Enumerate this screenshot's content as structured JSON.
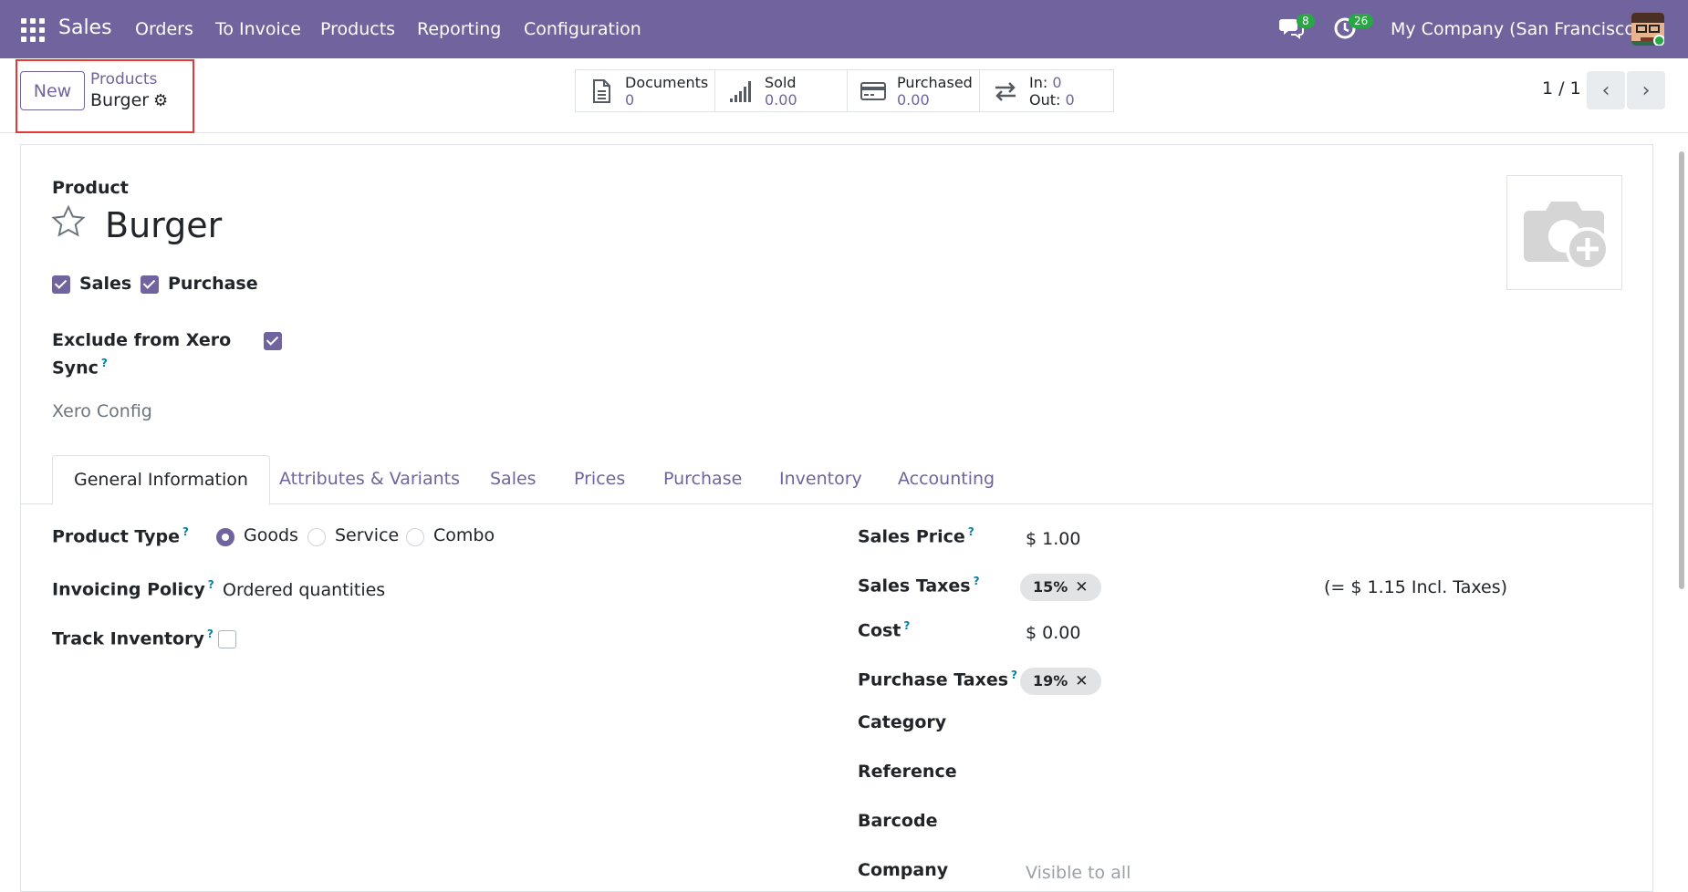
{
  "navbar": {
    "app_name": "Sales",
    "menu": [
      "Orders",
      "To Invoice",
      "Products",
      "Reporting",
      "Configuration"
    ],
    "messages_count": "8",
    "activities_count": "26",
    "company": "My Company (San Francisco)",
    "bg_color": "#71639e"
  },
  "control_panel": {
    "new_label": "New",
    "breadcrumb_parent": "Products",
    "breadcrumb_current": "Burger",
    "stats": [
      {
        "label": "Documents",
        "value": "0",
        "icon": "document-icon"
      },
      {
        "label": "Sold",
        "value": "0.00",
        "icon": "signal-chart-icon"
      },
      {
        "label": "Purchased",
        "value": "0.00",
        "icon": "credit-card-icon"
      }
    ],
    "moves": {
      "in_label": "In:",
      "in_value": "0",
      "out_label": "Out:",
      "out_value": "0"
    },
    "pager": "1 / 1"
  },
  "form": {
    "product_label": "Product",
    "product_name": "Burger",
    "sales_label": "Sales",
    "sales_checked": true,
    "purchase_label": "Purchase",
    "purchase_checked": true,
    "exclude_xero_label_1": "Exclude from Xero",
    "exclude_xero_label_2": "Sync",
    "exclude_xero_checked": true,
    "xero_config": "Xero Config",
    "tabs": [
      "General Information",
      "Attributes & Variants",
      "Sales",
      "Prices",
      "Purchase",
      "Inventory",
      "Accounting"
    ],
    "active_tab": "General Information",
    "product_type_label": "Product Type",
    "product_type_options": [
      "Goods",
      "Service",
      "Combo"
    ],
    "product_type_selected": "Goods",
    "invoicing_policy_label": "Invoicing Policy",
    "invoicing_policy_value": "Ordered quantities",
    "track_inventory_label": "Track Inventory",
    "track_inventory_checked": false,
    "sales_price_label": "Sales Price",
    "sales_price_value": "$ 1.00",
    "sales_taxes_label": "Sales Taxes",
    "sales_taxes_tag": "15%",
    "incl_taxes": "(= $ 1.15 Incl. Taxes)",
    "cost_label": "Cost",
    "cost_value": "$ 0.00",
    "purchase_taxes_label": "Purchase Taxes",
    "purchase_taxes_tag": "19%",
    "category_label": "Category",
    "reference_label": "Reference",
    "barcode_label": "Barcode",
    "company_label": "Company",
    "company_placeholder": "Visible to all",
    "help_mark": "?"
  }
}
